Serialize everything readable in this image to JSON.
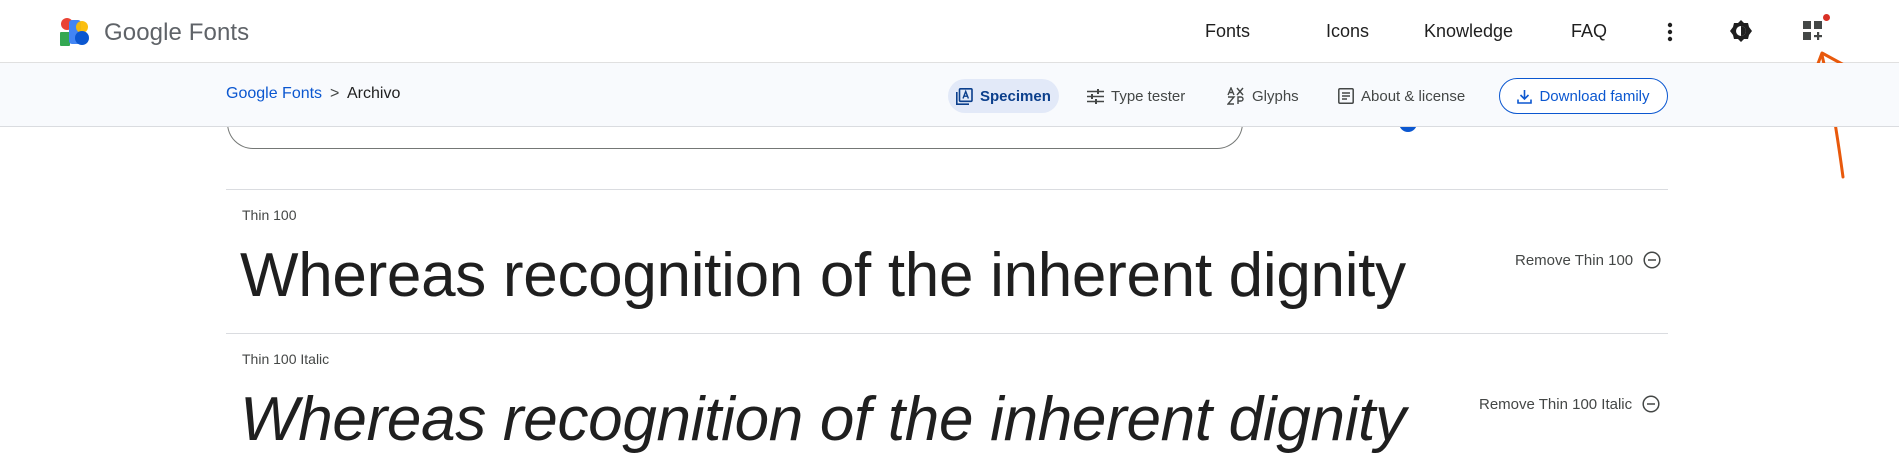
{
  "header": {
    "brand": "Google Fonts",
    "nav": [
      "Fonts",
      "Icons",
      "Knowledge",
      "FAQ"
    ],
    "icons": [
      "more-vert-icon",
      "theme-toggle-icon",
      "selected-families-icon"
    ]
  },
  "subheader": {
    "breadcrumb": {
      "root": "Google Fonts",
      "separator": ">",
      "current": "Archivo"
    },
    "tabs": [
      {
        "label": "Specimen",
        "icon": "specimen-icon",
        "active": true
      },
      {
        "label": "Type tester",
        "icon": "tune-icon",
        "active": false
      },
      {
        "label": "Glyphs",
        "icon": "glyphs-icon",
        "active": false
      },
      {
        "label": "About & license",
        "icon": "article-icon",
        "active": false
      }
    ],
    "download_label": "Download family"
  },
  "styles": [
    {
      "name": "Thin 100",
      "sample": "Whereas recognition of the inherent dignity",
      "remove_label": "Remove Thin 100"
    },
    {
      "name": "Thin 100 Italic",
      "sample": "Whereas recognition of the inherent dignity",
      "remove_label": "Remove Thin 100 Italic"
    }
  ],
  "colors": {
    "accent": "#0b57d0",
    "active_tab_bg": "#e2e9f8",
    "annotation": "#e8590c",
    "notification": "#d93025"
  }
}
